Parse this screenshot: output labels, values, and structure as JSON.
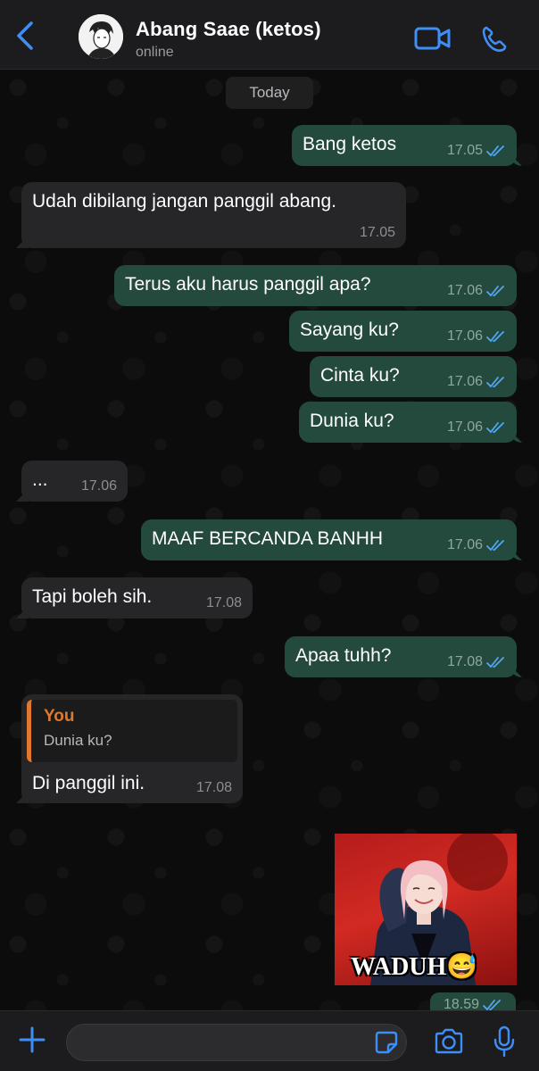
{
  "header": {
    "contact_name": "Abang Saae (ketos)",
    "status": "online"
  },
  "date_separator": "Today",
  "messages": [
    {
      "text": "Bang ketos",
      "time": "17.05",
      "direction": "outgoing",
      "read": true
    },
    {
      "text": "Udah dibilang jangan panggil abang.",
      "time": "17.05",
      "direction": "incoming"
    },
    {
      "text": "Terus aku harus panggil apa?",
      "time": "17.06",
      "direction": "outgoing",
      "read": true
    },
    {
      "text": "Sayang ku?",
      "time": "17.06",
      "direction": "outgoing",
      "read": true
    },
    {
      "text": "Cinta ku?",
      "time": "17.06",
      "direction": "outgoing",
      "read": true
    },
    {
      "text": "Dunia ku?",
      "time": "17.06",
      "direction": "outgoing",
      "read": true
    },
    {
      "text": "...",
      "time": "17.06",
      "direction": "incoming"
    },
    {
      "text": "MAAF BERCANDA BANHH",
      "time": "17.06",
      "direction": "outgoing",
      "read": true
    },
    {
      "text": "Tapi boleh sih.",
      "time": "17.08",
      "direction": "incoming"
    },
    {
      "text": "Apaa tuhh?",
      "time": "17.08",
      "direction": "outgoing",
      "read": true
    },
    {
      "text": "Di panggil ini.",
      "time": "17.08",
      "direction": "incoming",
      "reply": {
        "author": "You",
        "text": "Dunia ku?"
      }
    }
  ],
  "sticker": {
    "caption": "WADUH😅",
    "time": "18.59",
    "direction": "outgoing",
    "read": true
  },
  "composer": {
    "placeholder": ""
  },
  "colors": {
    "accent": "#3e8ef7",
    "outgoing_bubble": "#234a3c",
    "incoming_bubble": "#262628",
    "reply_author": "#e0782d",
    "read_tick": "#53a6f5"
  },
  "icons": [
    "back-chevron-icon",
    "video-call-icon",
    "phone-icon",
    "plus-icon",
    "sticker-icon",
    "camera-icon",
    "mic-icon",
    "double-check-icon"
  ]
}
